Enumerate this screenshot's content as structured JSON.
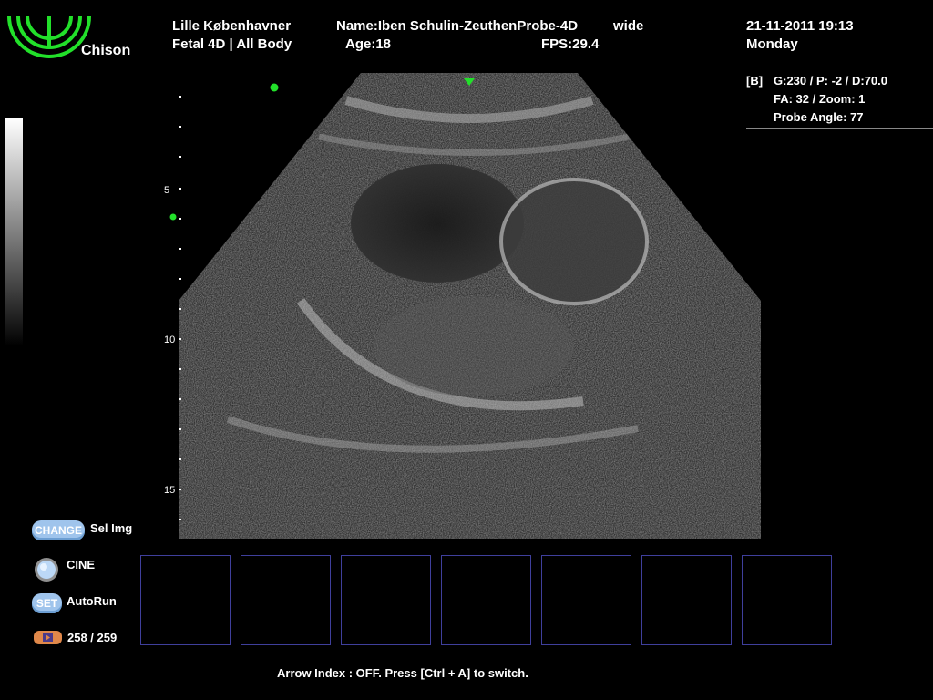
{
  "brand": {
    "name": "Chison",
    "logo_color": "#22e02a"
  },
  "header": {
    "hospital": "Lille Københavner",
    "exam": "Fetal 4D | All Body",
    "patient_name": "Name:Iben Schulin-ZeuthenProbe-4D",
    "probe_mode": "wide",
    "age": "Age:18",
    "fps": "FPS:29.4",
    "datetime": "21-11-2011  19:13",
    "weekday": "Monday"
  },
  "params": {
    "mode": "[B]",
    "line1": "G:230 / P: -2 / D:70.0",
    "line2": "FA: 32 / Zoom:  1",
    "line3": "Probe Angle:  77"
  },
  "depth_scale": {
    "labels": [
      "5",
      "10",
      "15"
    ]
  },
  "controls": {
    "change_pill": "CHANGE",
    "change_label": "Sel Img",
    "cine_label": "CINE",
    "set_pill": "SET",
    "autorun_label": "AutoRun",
    "frame_counter": "258 / 259"
  },
  "thumbnails": {
    "count": 7
  },
  "footer": {
    "message": "Arrow Index : OFF. Press [Ctrl + A] to switch."
  },
  "colors": {
    "marker": "#22e02a",
    "thumb_border": "#3f3f9c",
    "pill": "#9fc4ec",
    "frame_icon": "#e0884a"
  }
}
